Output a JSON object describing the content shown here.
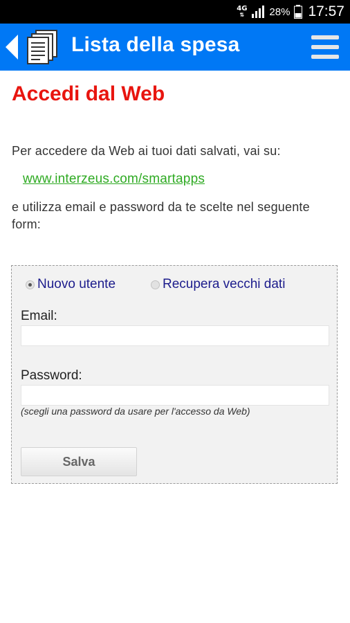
{
  "status_bar": {
    "network": "4G",
    "battery": "28%",
    "time": "17:57"
  },
  "app_bar": {
    "title": "Lista della spesa",
    "color": "#0078f5"
  },
  "page": {
    "title": "Accedi dal Web",
    "title_color": "#e8150f",
    "intro": "Per accedere da Web ai tuoi dati salvati, vai su:",
    "link": "www.interzeus.com/smartapps",
    "instructions": "e utilizza email e password da te scelte nel seguente form:"
  },
  "form": {
    "radio_new_user": "Nuovo utente",
    "radio_recover": "Recupera vecchi dati",
    "selected": "Nuovo utente",
    "email_label": "Email:",
    "email_value": "",
    "password_label": "Password:",
    "password_value": "",
    "password_hint": "(scegli una password da usare per l'accesso da Web)",
    "save_label": "Salva"
  }
}
